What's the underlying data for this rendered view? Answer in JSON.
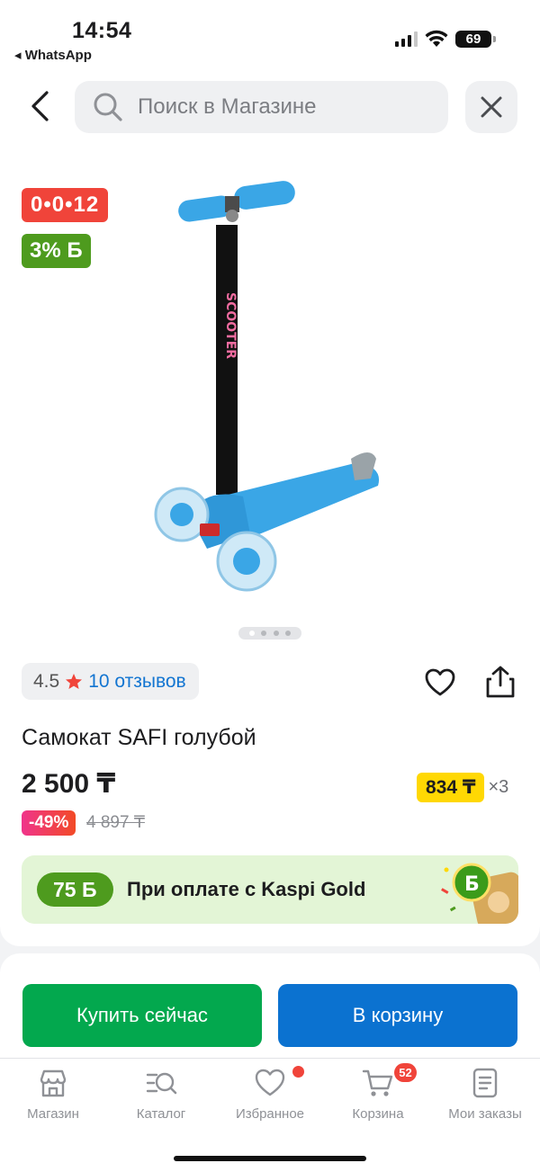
{
  "status_bar": {
    "time": "14:54",
    "back_app": "◂ WhatsApp",
    "battery": "69"
  },
  "search": {
    "placeholder": "Поиск в Магазине"
  },
  "product": {
    "badge_timer": "0•0•12",
    "badge_bonus": "3% Б",
    "rating": "4.5",
    "reviews": "10 отзывов",
    "title": "Самокат SAFI голубой",
    "price": "2 500 ₸",
    "discount": "-49%",
    "old_price": "4 897 ₸",
    "installment_price": "834 ₸",
    "installment_times": "×3",
    "gallery": {
      "total": 4,
      "active": 1
    }
  },
  "promo": {
    "bonus": "75 Б",
    "text": "При оплате с Kaspi Gold"
  },
  "actions": {
    "buy_now": "Купить сейчас",
    "add_to_cart": "В корзину"
  },
  "tabbar": {
    "items": [
      {
        "label": "Магазин",
        "icon": "store-icon"
      },
      {
        "label": "Каталог",
        "icon": "catalog-search-icon"
      },
      {
        "label": "Избранное",
        "icon": "heart-icon"
      },
      {
        "label": "Корзина",
        "icon": "cart-icon"
      },
      {
        "label": "Мои заказы",
        "icon": "orders-icon"
      }
    ],
    "cart_count": "52"
  },
  "colors": {
    "accent_red": "#f0443a",
    "bonus_green": "#4e9b1e",
    "buy_green": "#03a84e",
    "cart_blue": "#0b72d0",
    "link_blue": "#1375d1",
    "installment_yellow": "#ffd803"
  }
}
